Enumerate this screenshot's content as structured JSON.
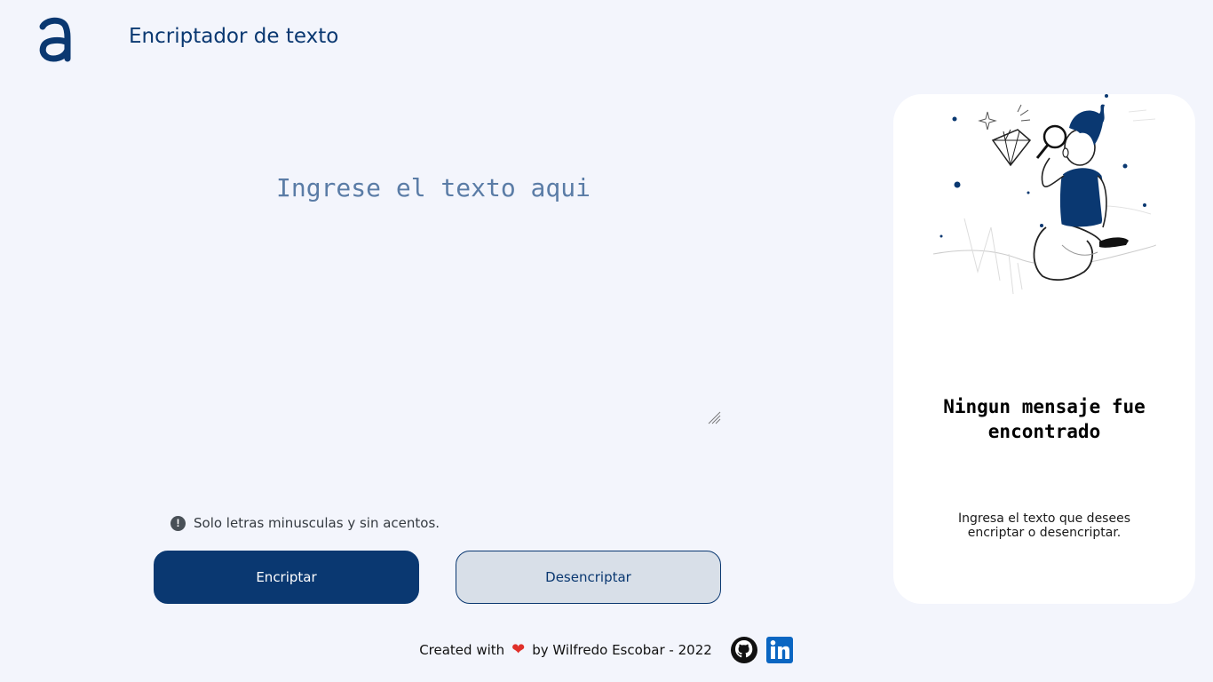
{
  "header": {
    "logo_icon": "alura-logo-icon",
    "title": "Encriptador de texto"
  },
  "input": {
    "placeholder": "Ingrese el texto aqui",
    "value": ""
  },
  "hint": {
    "icon": "exclamation-circle-icon",
    "text": "Solo letras minusculas y sin acentos."
  },
  "buttons": {
    "encrypt_label": "Encriptar",
    "decrypt_label": "Desencriptar"
  },
  "output_panel": {
    "illustration_icon": "person-with-magnifier-illustration",
    "title": "Ningun mensaje fue encontrado",
    "text": "Ingresa el texto que desees encriptar o desencriptar."
  },
  "footer": {
    "created_with": "Created with",
    "heart_icon": "heart-icon",
    "by_text": "by Wilfredo Escobar - 2022",
    "github_icon": "github-icon",
    "linkedin_icon": "linkedin-icon"
  },
  "colors": {
    "background": "#f3f5fc",
    "primary": "#0a3871",
    "secondary_button": "#d8dfe8",
    "panel": "#ffffff",
    "heart": "#e0302a",
    "linkedin": "#0a66c2"
  }
}
